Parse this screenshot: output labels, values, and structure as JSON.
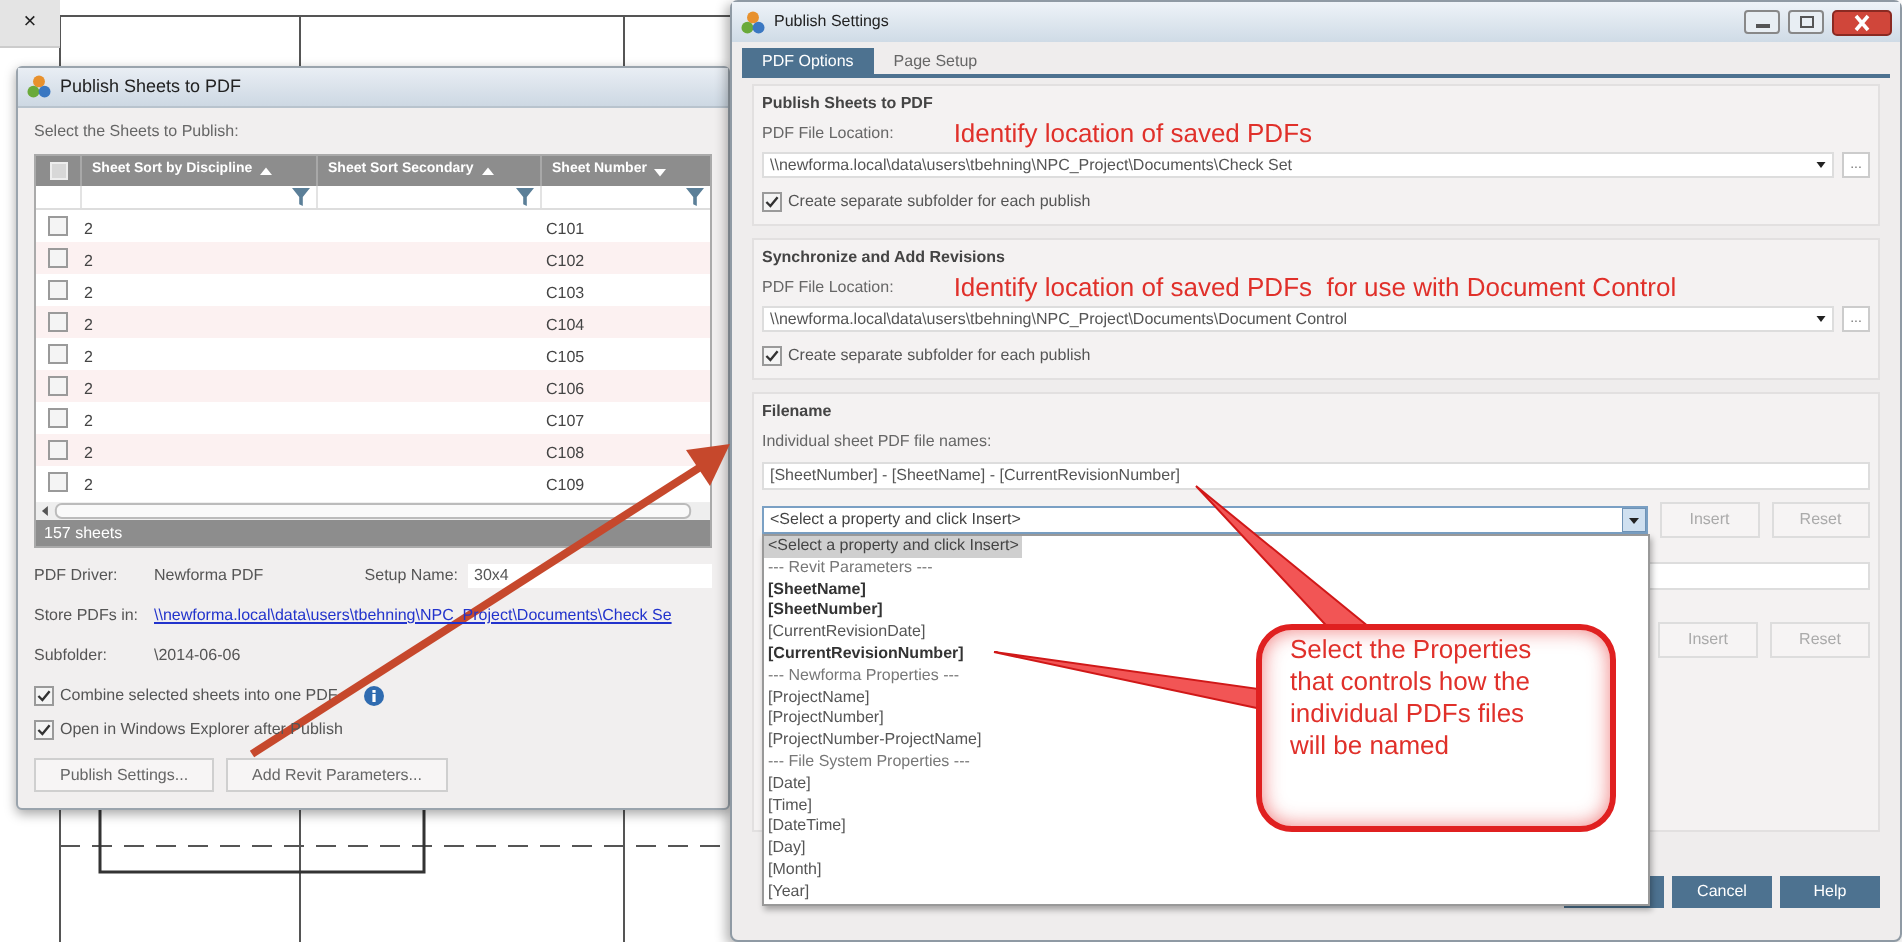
{
  "background": {
    "close_glyph": "×"
  },
  "publish_dialog": {
    "title": "Publish Sheets to PDF",
    "prompt": "Select the Sheets to Publish:",
    "all_checked": false,
    "columns": [
      {
        "label": "Sheet Sort by Discipline",
        "ascending": true
      },
      {
        "label": "Sheet Sort Secondary",
        "ascending": true
      },
      {
        "label": "Sheet Number",
        "ascending": false
      }
    ],
    "rows": [
      {
        "checked": false,
        "discipline": "2",
        "number": "C101"
      },
      {
        "checked": false,
        "discipline": "2",
        "number": "C102"
      },
      {
        "checked": false,
        "discipline": "2",
        "number": "C103"
      },
      {
        "checked": false,
        "discipline": "2",
        "number": "C104"
      },
      {
        "checked": false,
        "discipline": "2",
        "number": "C105"
      },
      {
        "checked": false,
        "discipline": "2",
        "number": "C106"
      },
      {
        "checked": false,
        "discipline": "2",
        "number": "C107"
      },
      {
        "checked": false,
        "discipline": "2",
        "number": "C108"
      },
      {
        "checked": false,
        "discipline": "2",
        "number": "C109"
      }
    ],
    "count": "157 sheets",
    "driver": {
      "label": "PDF Driver:",
      "value": "Newforma PDF"
    },
    "setup": {
      "label": "Setup Name:",
      "value": "30x4"
    },
    "store": {
      "label": "Store PDFs in:",
      "link": "\\\\newforma.local\\data\\users\\tbehning\\NPC_Project\\Documents\\Check Se"
    },
    "subfolder": {
      "label": "Subfolder:",
      "value": "\\2014-06-06"
    },
    "options": [
      {
        "label": "Combine selected sheets into one PDF",
        "checked": true,
        "info": true
      },
      {
        "label": "Open in Windows Explorer after Publish",
        "checked": true,
        "info": false
      }
    ],
    "buttons": [
      "Publish Settings...",
      "Add Revit Parameters..."
    ]
  },
  "settings_dialog": {
    "title": "Publish Settings",
    "tabs": [
      {
        "label": "PDF Options",
        "selected": true
      },
      {
        "label": "Page Setup",
        "selected": false
      }
    ],
    "sections": [
      {
        "heading": "Publish Sheets to PDF",
        "location_label": "PDF File Location:",
        "annotation": "Identify location of saved PDFs",
        "path": "\\\\newforma.local\\data\\users\\tbehning\\NPC_Project\\Documents\\Check Set",
        "browse": "...",
        "subfolder": {
          "label": "Create separate subfolder for each publish",
          "checked": true
        }
      },
      {
        "heading": "Synchronize and Add Revisions",
        "location_label": "PDF File Location:",
        "annotation": "Identify location of saved PDFs  for use with Document Control",
        "path": "\\\\newforma.local\\data\\users\\tbehning\\NPC_Project\\Documents\\Document Control",
        "browse": "...",
        "subfolder": {
          "label": "Create separate subfolder for each publish",
          "checked": true
        }
      }
    ],
    "filename": {
      "heading": "Filename",
      "label": "Individual sheet PDF file names:",
      "value": "[SheetNumber] - [SheetName] - [CurrentRevisionNumber]",
      "picker": "<Select a property and click Insert>",
      "buttons": [
        {
          "label": "Insert",
          "disabled": true
        },
        {
          "label": "Reset",
          "disabled": true
        }
      ],
      "second_buttons": [
        {
          "label": "Insert",
          "disabled": true
        },
        {
          "label": "Reset",
          "disabled": true
        }
      ],
      "list": [
        {
          "kind": "prompt",
          "label": "<Select a property and click Insert>",
          "selected": true
        },
        {
          "kind": "group",
          "label": "--- Revit Parameters ---",
          "selected": false
        },
        {
          "kind": "bold",
          "label": "[SheetName]",
          "selected": false
        },
        {
          "kind": "bold",
          "label": "[SheetNumber]",
          "selected": false
        },
        {
          "kind": "plain",
          "label": "[CurrentRevisionDate]",
          "selected": false
        },
        {
          "kind": "bold",
          "label": "[CurrentRevisionNumber]",
          "selected": false
        },
        {
          "kind": "group",
          "label": "--- Newforma Properties ---",
          "selected": false
        },
        {
          "kind": "plain",
          "label": "[ProjectName]",
          "selected": false
        },
        {
          "kind": "plain",
          "label": "[ProjectNumber]",
          "selected": false
        },
        {
          "kind": "plain",
          "label": "[ProjectNumber-ProjectName]",
          "selected": false
        },
        {
          "kind": "group",
          "label": "--- File System Properties ---",
          "selected": false
        },
        {
          "kind": "plain",
          "label": "[Date]",
          "selected": false
        },
        {
          "kind": "plain",
          "label": "[Time]",
          "selected": false
        },
        {
          "kind": "plain",
          "label": "[DateTime]",
          "selected": false
        },
        {
          "kind": "plain",
          "label": "[Day]",
          "selected": false
        },
        {
          "kind": "plain",
          "label": "[Month]",
          "selected": false
        },
        {
          "kind": "plain",
          "label": "[Year]",
          "selected": false
        }
      ]
    },
    "footer_buttons": [
      "Cancel",
      "Help"
    ]
  },
  "callout": {
    "text": "Select the Properties that controls how the individual PDFs files will be named"
  }
}
